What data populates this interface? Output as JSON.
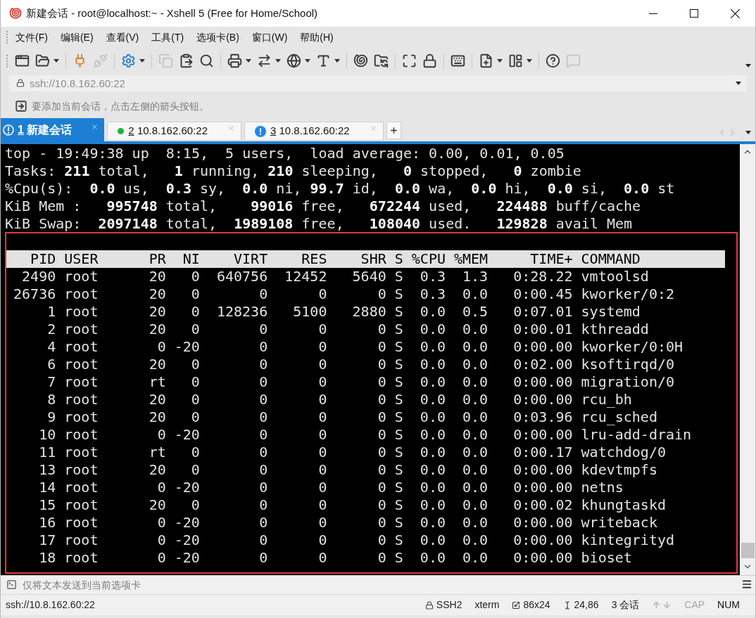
{
  "window": {
    "title": "新建会话 - root@localhost:~ - Xshell 5 (Free for Home/School)"
  },
  "menu": [
    "文件(F)",
    "编辑(E)",
    "查看(V)",
    "工具(T)",
    "选项卡(B)",
    "窗口(W)",
    "帮助(H)"
  ],
  "toolbar": [
    {
      "kind": "new-session",
      "dropdown": false,
      "disabled": false
    },
    {
      "kind": "open",
      "dropdown": true,
      "disabled": false
    },
    {
      "kind": "separator"
    },
    {
      "kind": "connect",
      "dropdown": false,
      "disabled": false
    },
    {
      "kind": "disconnect",
      "dropdown": false,
      "disabled": true
    },
    {
      "kind": "separator"
    },
    {
      "kind": "properties",
      "dropdown": true,
      "disabled": false
    },
    {
      "kind": "separator"
    },
    {
      "kind": "copy",
      "dropdown": false,
      "disabled": true
    },
    {
      "kind": "paste",
      "dropdown": false,
      "disabled": false
    },
    {
      "kind": "find",
      "dropdown": false,
      "disabled": false
    },
    {
      "kind": "separator"
    },
    {
      "kind": "print",
      "dropdown": true,
      "disabled": false
    },
    {
      "kind": "transfer",
      "dropdown": true,
      "disabled": false
    },
    {
      "kind": "globe",
      "dropdown": true,
      "disabled": false
    },
    {
      "kind": "font",
      "dropdown": true,
      "disabled": false
    },
    {
      "kind": "separator"
    },
    {
      "kind": "shell",
      "dropdown": false,
      "disabled": false
    },
    {
      "kind": "ftp",
      "dropdown": false,
      "disabled": false
    },
    {
      "kind": "separator"
    },
    {
      "kind": "fullscreen",
      "dropdown": false,
      "disabled": false
    },
    {
      "kind": "lock",
      "dropdown": false,
      "disabled": false
    },
    {
      "kind": "separator"
    },
    {
      "kind": "keyboard",
      "dropdown": false,
      "disabled": false
    },
    {
      "kind": "separator"
    },
    {
      "kind": "new-tab",
      "dropdown": true,
      "disabled": false
    },
    {
      "kind": "layout",
      "dropdown": true,
      "disabled": false
    },
    {
      "kind": "separator"
    },
    {
      "kind": "help",
      "dropdown": false,
      "disabled": false
    },
    {
      "kind": "chat",
      "dropdown": false,
      "disabled": true
    }
  ],
  "address_bar": {
    "value": "ssh://10.8.162.60:22"
  },
  "hint_bar": {
    "text": "要添加当前会话，点击左侧的箭头按钮。"
  },
  "tabs": [
    {
      "number": "1",
      "label": "新建会话",
      "kind": "warning",
      "selected": true
    },
    {
      "number": "2",
      "label": "10.8.162.60:22",
      "kind": "connected",
      "selected": false
    },
    {
      "number": "3",
      "label": "10.8.162.60:22",
      "kind": "warning",
      "selected": false
    }
  ],
  "terminal": {
    "summary": [
      "top - 19:49:38 up  8:15,  5 users,  load average: 0.00, 0.01, 0.05",
      "Tasks: **211** total,   **1** running, **210** sleeping,   **0** stopped,   **0** zombie",
      "%Cpu(s):  **0.0** us,  **0.3** sy,  **0.0** ni, **99.7** id,  **0.0** wa,  **0.0** hi,  **0.0** si,  **0.0** st",
      "KiB Mem :   **995748** total,    **99016** free,   **672244** used,   **224488** buff/cache",
      "KiB Swap:  **2097148** total,  **1989108** free,   **108040** used.   **129828** avail Mem"
    ],
    "table": {
      "columns": [
        "PID",
        "USER",
        "PR",
        "NI",
        "VIRT",
        "RES",
        "SHR",
        "S",
        "%CPU",
        "%MEM",
        "TIME+",
        "COMMAND"
      ],
      "rows": [
        [
          "2490",
          "root",
          "20",
          "0",
          "640756",
          "12452",
          "5640",
          "S",
          "0.3",
          "1.3",
          "0:28.22",
          "vmtoolsd"
        ],
        [
          "26736",
          "root",
          "20",
          "0",
          "0",
          "0",
          "0",
          "S",
          "0.3",
          "0.0",
          "0:00.45",
          "kworker/0:2"
        ],
        [
          "1",
          "root",
          "20",
          "0",
          "128236",
          "5100",
          "2880",
          "S",
          "0.0",
          "0.5",
          "0:07.01",
          "systemd"
        ],
        [
          "2",
          "root",
          "20",
          "0",
          "0",
          "0",
          "0",
          "S",
          "0.0",
          "0.0",
          "0:00.01",
          "kthreadd"
        ],
        [
          "4",
          "root",
          "0",
          "-20",
          "0",
          "0",
          "0",
          "S",
          "0.0",
          "0.0",
          "0:00.00",
          "kworker/0:0H"
        ],
        [
          "6",
          "root",
          "20",
          "0",
          "0",
          "0",
          "0",
          "S",
          "0.0",
          "0.0",
          "0:02.00",
          "ksoftirqd/0"
        ],
        [
          "7",
          "root",
          "rt",
          "0",
          "0",
          "0",
          "0",
          "S",
          "0.0",
          "0.0",
          "0:00.00",
          "migration/0"
        ],
        [
          "8",
          "root",
          "20",
          "0",
          "0",
          "0",
          "0",
          "S",
          "0.0",
          "0.0",
          "0:00.00",
          "rcu_bh"
        ],
        [
          "9",
          "root",
          "20",
          "0",
          "0",
          "0",
          "0",
          "S",
          "0.0",
          "0.0",
          "0:03.96",
          "rcu_sched"
        ],
        [
          "10",
          "root",
          "0",
          "-20",
          "0",
          "0",
          "0",
          "S",
          "0.0",
          "0.0",
          "0:00.00",
          "lru-add-drain"
        ],
        [
          "11",
          "root",
          "rt",
          "0",
          "0",
          "0",
          "0",
          "S",
          "0.0",
          "0.0",
          "0:00.17",
          "watchdog/0"
        ],
        [
          "13",
          "root",
          "20",
          "0",
          "0",
          "0",
          "0",
          "S",
          "0.0",
          "0.0",
          "0:00.00",
          "kdevtmpfs"
        ],
        [
          "14",
          "root",
          "0",
          "-20",
          "0",
          "0",
          "0",
          "S",
          "0.0",
          "0.0",
          "0:00.00",
          "netns"
        ],
        [
          "15",
          "root",
          "20",
          "0",
          "0",
          "0",
          "0",
          "S",
          "0.0",
          "0.0",
          "0:00.02",
          "khungtaskd"
        ],
        [
          "16",
          "root",
          "0",
          "-20",
          "0",
          "0",
          "0",
          "S",
          "0.0",
          "0.0",
          "0:00.00",
          "writeback"
        ],
        [
          "17",
          "root",
          "0",
          "-20",
          "0",
          "0",
          "0",
          "S",
          "0.0",
          "0.0",
          "0:00.00",
          "kintegrityd"
        ],
        [
          "18",
          "root",
          "0",
          "-20",
          "0",
          "0",
          "0",
          "S",
          "0.0",
          "0.0",
          "0:00.00",
          "bioset"
        ]
      ]
    }
  },
  "compose_bar": {
    "placeholder": "仅将文本发送到当前选项卡"
  },
  "status_bar": {
    "address": "ssh://10.8.162.60:22",
    "items": [
      {
        "kind": "protocol",
        "text": "SSH2"
      },
      {
        "kind": "terminal-type",
        "text": "xterm"
      },
      {
        "kind": "size",
        "text": "86x24"
      },
      {
        "kind": "cursor",
        "text": "24,86"
      },
      {
        "kind": "sessions",
        "text": "3 会话"
      },
      {
        "kind": "arrows"
      },
      {
        "kind": "caps-lock",
        "text": "CAP",
        "on": false
      },
      {
        "kind": "num-lock",
        "text": "NUM",
        "on": true
      }
    ]
  }
}
